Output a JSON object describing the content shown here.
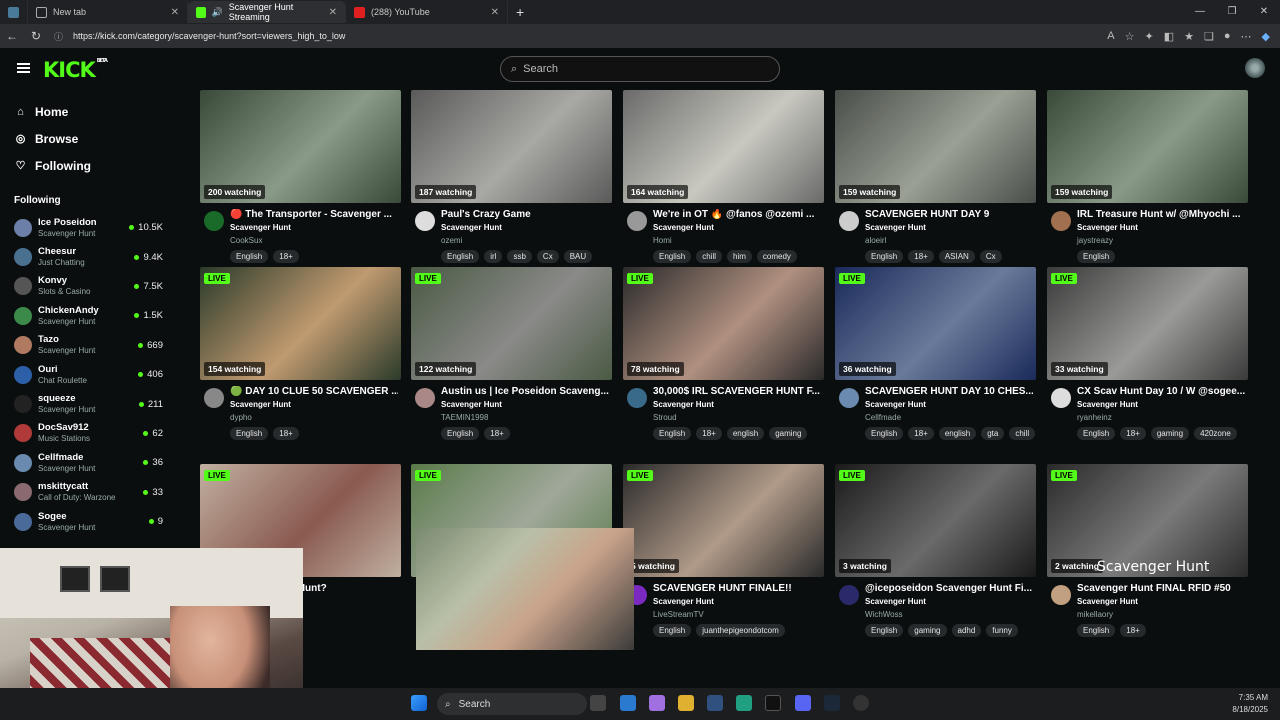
{
  "browser": {
    "tabs": [
      {
        "label": "New tab",
        "active": false
      },
      {
        "label": "Scavenger Hunt Streaming",
        "active": true
      },
      {
        "label": "(288) YouTube",
        "active": false
      }
    ],
    "url": "https://kick.com/category/scavenger-hunt?sort=viewers_high_to_low"
  },
  "app": {
    "logo": "KICK",
    "logo_badge": "BETA",
    "search_placeholder": "Search"
  },
  "sidebar": {
    "nav": [
      {
        "label": "Home",
        "icon": "home-icon"
      },
      {
        "label": "Browse",
        "icon": "compass-icon"
      },
      {
        "label": "Following",
        "icon": "heart-icon"
      }
    ],
    "following_title": "Following",
    "following": [
      {
        "name": "Ice Poseidon",
        "category": "Scavenger Hunt",
        "viewers": "10.5K",
        "color": "#6b7fa8"
      },
      {
        "name": "Cheesur",
        "category": "Just Chatting",
        "viewers": "9.4K",
        "color": "#4a7090"
      },
      {
        "name": "Konvy",
        "category": "Slots & Casino",
        "viewers": "7.5K",
        "color": "#555"
      },
      {
        "name": "ChickenAndy",
        "category": "Scavenger Hunt",
        "viewers": "1.5K",
        "color": "#3c8a4a"
      },
      {
        "name": "Tazo",
        "category": "Scavenger Hunt",
        "viewers": "669",
        "color": "#b07a60"
      },
      {
        "name": "Ouri",
        "category": "Chat Roulette",
        "viewers": "406",
        "color": "#2d5fa8"
      },
      {
        "name": "squeeze",
        "category": "Scavenger Hunt",
        "viewers": "211",
        "color": "#222"
      },
      {
        "name": "DocSav912",
        "category": "Music Stations",
        "viewers": "62",
        "color": "#b03a3a"
      },
      {
        "name": "Cellfmade",
        "category": "Scavenger Hunt",
        "viewers": "36",
        "color": "#6a8ab0"
      },
      {
        "name": "mskittycatt",
        "category": "Call of Duty: Warzone",
        "viewers": "33",
        "color": "#8a6a70"
      },
      {
        "name": "Sogee",
        "category": "Scavenger Hunt",
        "viewers": "9",
        "color": "#4a6a9a"
      }
    ]
  },
  "streams": [
    {
      "watching": "200 watching",
      "live": false,
      "title": "🔴 The Transporter - Scavenger ...",
      "category": "Scavenger Hunt",
      "channel": "CookSux",
      "tags": [
        "English",
        "18+"
      ],
      "thumb": [
        "#3a4a3a",
        "#8a9a88"
      ],
      "avatar": "#1a6a2a"
    },
    {
      "watching": "187 watching",
      "live": false,
      "title": "Paul's Crazy Game",
      "category": "Scavenger Hunt",
      "channel": "ozemi",
      "tags": [
        "English",
        "irl",
        "ssb",
        "Cx",
        "BAU"
      ],
      "thumb": [
        "#5a5a5a",
        "#a8a8a4"
      ],
      "avatar": "#ddd"
    },
    {
      "watching": "164 watching",
      "live": false,
      "title": "We're in OT 🔥 @fanos @ozemi ...",
      "category": "Scavenger Hunt",
      "channel": "Homi",
      "tags": [
        "English",
        "chill",
        "him",
        "comedy"
      ],
      "thumb": [
        "#6a6a6a",
        "#c8c8c0"
      ],
      "avatar": "#999"
    },
    {
      "watching": "159 watching",
      "live": false,
      "title": "SCAVENGER HUNT DAY 9",
      "category": "Scavenger Hunt",
      "channel": "aloeirl",
      "tags": [
        "English",
        "18+",
        "ASIAN",
        "Cx"
      ],
      "thumb": [
        "#4a4e4a",
        "#9aa094"
      ],
      "avatar": "#ccc"
    },
    {
      "watching": "159 watching",
      "live": false,
      "title": "IRL Treasure Hunt w/ @Mhyochi ...",
      "category": "Scavenger Hunt",
      "channel": "jaystreazy",
      "tags": [
        "English"
      ],
      "thumb": [
        "#3a4a3a",
        "#8a9a88"
      ],
      "avatar": "#a07050"
    },
    {
      "watching": "154 watching",
      "live": true,
      "title": "🟢 DAY 10 CLUE 50 SCAVENGER ...",
      "category": "Scavenger Hunt",
      "channel": "dypho",
      "tags": [
        "English",
        "18+"
      ],
      "thumb": [
        "#2a3a2a",
        "#c09a70"
      ],
      "avatar": "#888"
    },
    {
      "watching": "122 watching",
      "live": true,
      "title": "Austin us | Ice Poseidon Scaveng...",
      "category": "Scavenger Hunt",
      "channel": "TAEMIN1998",
      "tags": [
        "English",
        "18+"
      ],
      "thumb": [
        "#4a5a44",
        "#8a8a88"
      ],
      "avatar": "#a88"
    },
    {
      "watching": "78 watching",
      "live": true,
      "title": "30,000$ IRL SCAVENGER HUNT F...",
      "category": "Scavenger Hunt",
      "channel": "Stroud",
      "tags": [
        "English",
        "18+",
        "english",
        "gaming"
      ],
      "thumb": [
        "#2a2a2a",
        "#b09080"
      ],
      "avatar": "#3a6a8a"
    },
    {
      "watching": "36 watching",
      "live": true,
      "title": "SCAVENGER HUNT DAY 10 CHES...",
      "category": "Scavenger Hunt",
      "channel": "Cellfmade",
      "tags": [
        "English",
        "18+",
        "english",
        "gta",
        "chill"
      ],
      "thumb": [
        "#1a2a5a",
        "#6a7a9a"
      ],
      "avatar": "#6a8ab0"
    },
    {
      "watching": "33 watching",
      "live": true,
      "title": "CX Scav Hunt Day 10 / W @sogee...",
      "category": "Scavenger Hunt",
      "channel": "ryanheinz",
      "tags": [
        "English",
        "18+",
        "gaming",
        "420zone"
      ],
      "thumb": [
        "#3a3a3a",
        "#9a9a98"
      ],
      "avatar": "#ddd"
    },
    {
      "watching": "",
      "live": true,
      "title": "he Scavenger Hunt?",
      "category": "",
      "channel": "",
      "tags": [],
      "thumb": [
        "#c0b0a0",
        "#8a5a50"
      ],
      "avatar": "#0b0e0f"
    },
    {
      "watching": "",
      "live": true,
      "title": "",
      "category": "",
      "channel": "",
      "tags": [],
      "thumb": [
        "#5a7a4a",
        "#a0a89a"
      ],
      "avatar": "#0b0e0f"
    },
    {
      "watching": "5 watching",
      "live": true,
      "title": "SCAVENGER HUNT FINALE!!",
      "category": "Scavenger Hunt",
      "channel": "LiveStreamTV",
      "tags": [
        "English",
        "juanthepigeondotcom"
      ],
      "thumb": [
        "#2a2a2a",
        "#b09a88"
      ],
      "avatar": "#7a2ac0"
    },
    {
      "watching": "3 watching",
      "live": true,
      "title": "@iceposeidon Scavenger Hunt Fi...",
      "category": "Scavenger Hunt",
      "channel": "WichWoss",
      "tags": [
        "English",
        "gaming",
        "adhd",
        "funny"
      ],
      "thumb": [
        "#1a1a1a",
        "#6a6a6a"
      ],
      "avatar": "#2a2a6a"
    },
    {
      "watching": "2 watching",
      "live": true,
      "title": "Scavenger Hunt FINAL RFID #50",
      "category": "Scavenger Hunt",
      "channel": "mikellaory",
      "tags": [
        "English",
        "18+"
      ],
      "thumb": [
        "#2a2a2a",
        "#7a7a7a"
      ],
      "avatar": "#c0a080"
    }
  ],
  "overlay_text": {
    "thumb_caption": "Scavenger Hunt"
  },
  "taskbar": {
    "search_label": "Search",
    "time": "7:35 AM",
    "date": "8/18/2025"
  },
  "colors": {
    "accent": "#53fc18",
    "background": "#0b0e0f",
    "tag_bg": "#262a2d"
  }
}
